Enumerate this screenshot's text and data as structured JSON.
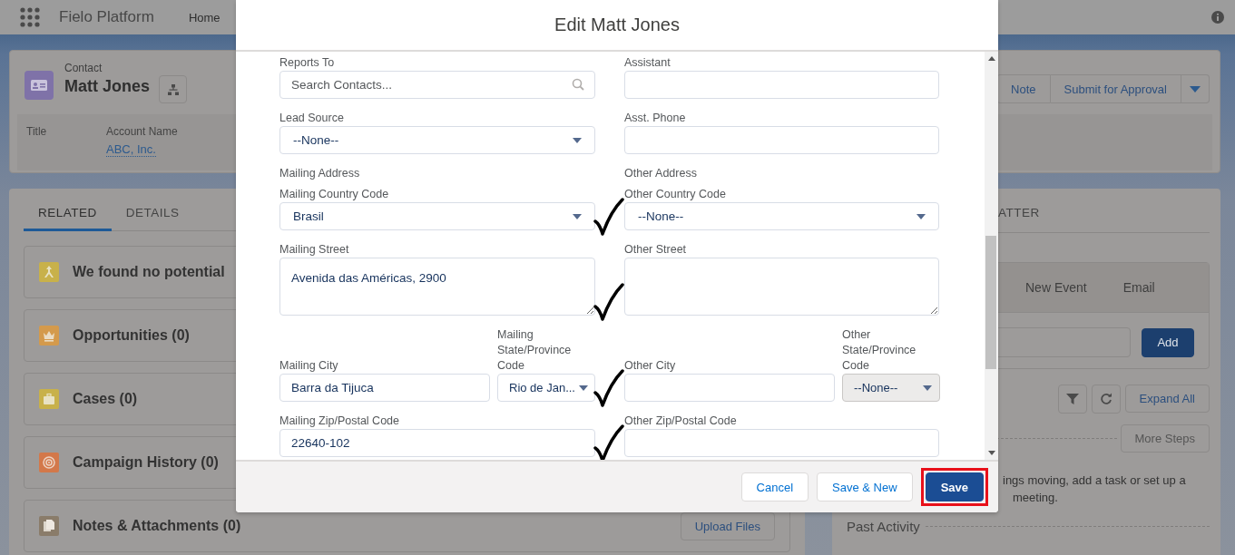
{
  "app": {
    "name": "Fielo Platform",
    "nav": [
      "Home"
    ]
  },
  "record": {
    "type": "Contact",
    "name": "Matt Jones",
    "fields": [
      {
        "label": "Title"
      },
      {
        "label": "Account Name",
        "value": "ABC, Inc."
      }
    ],
    "actions": [
      "Note",
      "Submit for Approval"
    ]
  },
  "tabs": [
    {
      "label": "RELATED",
      "selected": true
    },
    {
      "label": "DETAILS",
      "selected": false
    }
  ],
  "related_lists": [
    {
      "kind": "duplicates",
      "title": "We found no potential",
      "color": "#c8b14a"
    },
    {
      "kind": "opportunities",
      "title": "Opportunities (0)",
      "color": "#d49a4c"
    },
    {
      "kind": "cases",
      "title": "Cases (0)",
      "color": "#c8b14a"
    },
    {
      "kind": "campaigns",
      "title": "Campaign History (0)",
      "color": "#d3784a"
    },
    {
      "kind": "notes",
      "title": "Notes & Attachments (0)",
      "color": "#8a7c6a",
      "button": "Upload Files"
    }
  ],
  "activity": {
    "tab": "ATTER",
    "composer_tabs": [
      "New Event",
      "Email"
    ],
    "add_button": "Add",
    "expand_all": "Expand All",
    "more_steps": "More Steps",
    "empty_text": [
      "ings moving, add a task or set up a",
      "meeting."
    ],
    "past_activity": "Past Activity"
  },
  "modal": {
    "title": "Edit Matt Jones",
    "rows": [
      {
        "checked": false,
        "left": [
          {
            "kind": "lookup",
            "label": "Reports To",
            "placeholder": "Search Contacts..."
          }
        ],
        "right": [
          {
            "kind": "text",
            "label": "Assistant"
          }
        ]
      },
      {
        "checked": false,
        "left": [
          {
            "kind": "picklist",
            "label": "Lead Source",
            "value": "--None--",
            "disabled": false
          }
        ],
        "right": [
          {
            "kind": "text",
            "label": "Asst. Phone"
          }
        ]
      },
      {
        "checked": false,
        "left": [
          {
            "kind": "heading",
            "label": "Mailing Address"
          }
        ],
        "right": [
          {
            "kind": "heading",
            "label": "Other Address"
          }
        ]
      },
      {
        "checked": true,
        "left": [
          {
            "kind": "picklist",
            "label": "Mailing Country Code",
            "value": "Brasil",
            "disabled": false
          }
        ],
        "right": [
          {
            "kind": "picklist",
            "label": "Other Country Code",
            "value": "--None--",
            "disabled": false
          }
        ]
      },
      {
        "checked": true,
        "left": [
          {
            "kind": "textarea",
            "label": "Mailing Street",
            "value": "Avenida das Américas, 2900"
          }
        ],
        "right": [
          {
            "kind": "textarea",
            "label": "Other Street"
          }
        ]
      },
      {
        "checked": true,
        "left": [
          {
            "kind": "text",
            "label": "Mailing City",
            "value": "Barra da Tijuca"
          },
          {
            "kind": "picklist",
            "label": "Mailing State/Province Code",
            "value": "Rio de Jan...",
            "disabled": false
          }
        ],
        "right": [
          {
            "kind": "text",
            "label": "Other City"
          },
          {
            "kind": "picklist",
            "label": "Other State/Province Code",
            "value": "--None--",
            "disabled": true
          }
        ]
      },
      {
        "checked": true,
        "left": [
          {
            "kind": "text",
            "label": "Mailing Zip/Postal Code",
            "value": "22640-102"
          }
        ],
        "right": [
          {
            "kind": "text",
            "label": "Other Zip/Postal Code"
          }
        ]
      }
    ],
    "buttons": [
      {
        "label": "Cancel",
        "kind": "neutral",
        "highlighted": false
      },
      {
        "label": "Save & New",
        "kind": "neutral",
        "highlighted": false
      },
      {
        "label": "Save",
        "kind": "brand",
        "highlighted": true
      }
    ]
  }
}
